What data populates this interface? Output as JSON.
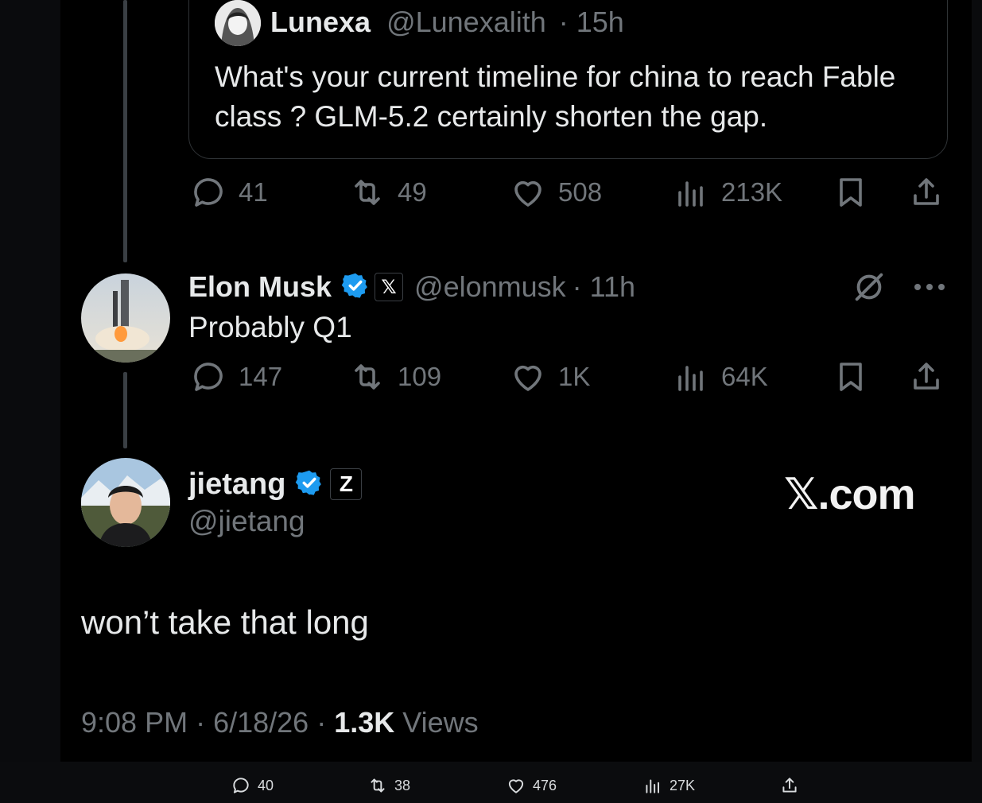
{
  "quoted": {
    "name": "Lunexa",
    "handle": "@Lunexalith",
    "time": "· 15h",
    "text": "What's your current timeline for china to reach Fable class ? GLM-5.2 certainly shorten the gap."
  },
  "quoted_actions": {
    "replies": "41",
    "reposts": "49",
    "likes": "508",
    "views": "213K"
  },
  "reply": {
    "name": "Elon Musk",
    "affiliation": "𝕏",
    "handle": "@elonmusk",
    "time": "· 11h",
    "text": "Probably Q1"
  },
  "reply_actions": {
    "replies": "147",
    "reposts": "109",
    "likes": "1K",
    "views": "64K"
  },
  "main": {
    "name": "jietang",
    "affiliation": "Z",
    "handle": "@jietang",
    "brand": "𝕏.com",
    "text": "won’t take that long",
    "time": "9:08 PM",
    "date": "6/18/26",
    "views_count": "1.3K",
    "views_label": "Views"
  },
  "bottom_actions": {
    "replies": "40",
    "reposts": "38",
    "likes": "476",
    "views": "27K"
  },
  "colors": {
    "verified": "#1d9bf0",
    "muted": "#71767b",
    "text": "#e7e9ea"
  }
}
